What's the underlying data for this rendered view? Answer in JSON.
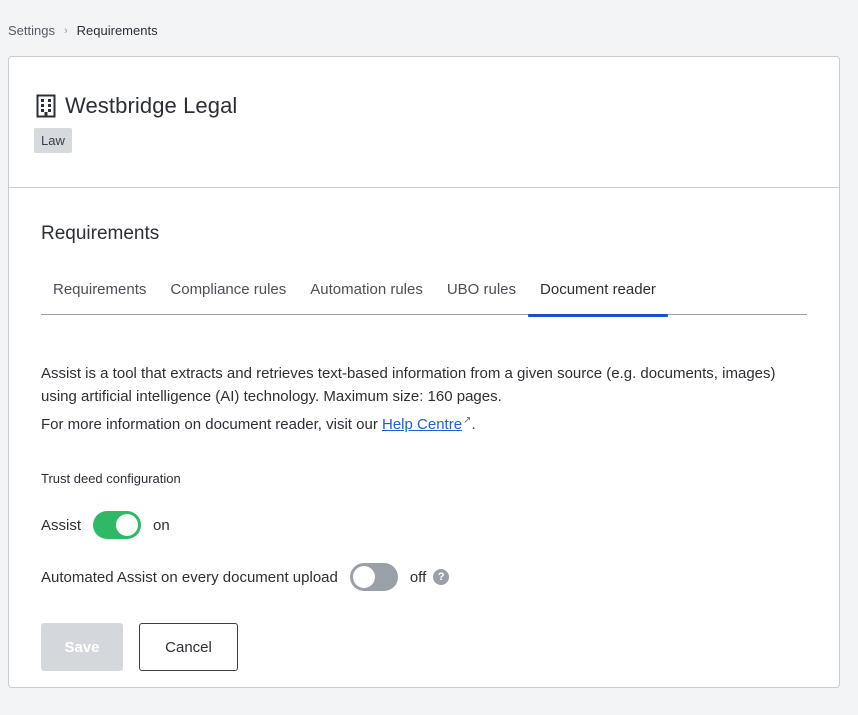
{
  "breadcrumb": {
    "parent": "Settings",
    "separator": "›",
    "current": "Requirements"
  },
  "organization": {
    "name": "Westbridge Legal",
    "icon": "building-icon",
    "tag": "Law"
  },
  "section": {
    "title": "Requirements"
  },
  "tabs": [
    {
      "label": "Requirements",
      "active": false
    },
    {
      "label": "Compliance rules",
      "active": false
    },
    {
      "label": "Automation rules",
      "active": false
    },
    {
      "label": "UBO rules",
      "active": false
    },
    {
      "label": "Document reader",
      "active": true
    }
  ],
  "content": {
    "description": "Assist is a tool that extracts and retrieves text-based information from a given source (e.g. documents, images) using artificial intelligence (AI) technology. Maximum size: 160 pages.",
    "more_info_prefix": "For more information on document reader, visit our ",
    "help_link": "Help Centre",
    "external_icon": "↗",
    "more_info_suffix": ".",
    "config_title": "Trust deed configuration",
    "assist": {
      "label": "Assist",
      "state_label": "on",
      "enabled": true
    },
    "auto_assist": {
      "label": "Automated Assist on every document upload",
      "state_label": "off",
      "enabled": false,
      "help_icon": "?"
    }
  },
  "actions": {
    "save_label": "Save",
    "cancel_label": "Cancel"
  },
  "colors": {
    "accent": "#1f4fc7",
    "toggle_on": "#2fb865",
    "toggle_off": "#9aa0a8",
    "link": "#1f5fd6"
  }
}
